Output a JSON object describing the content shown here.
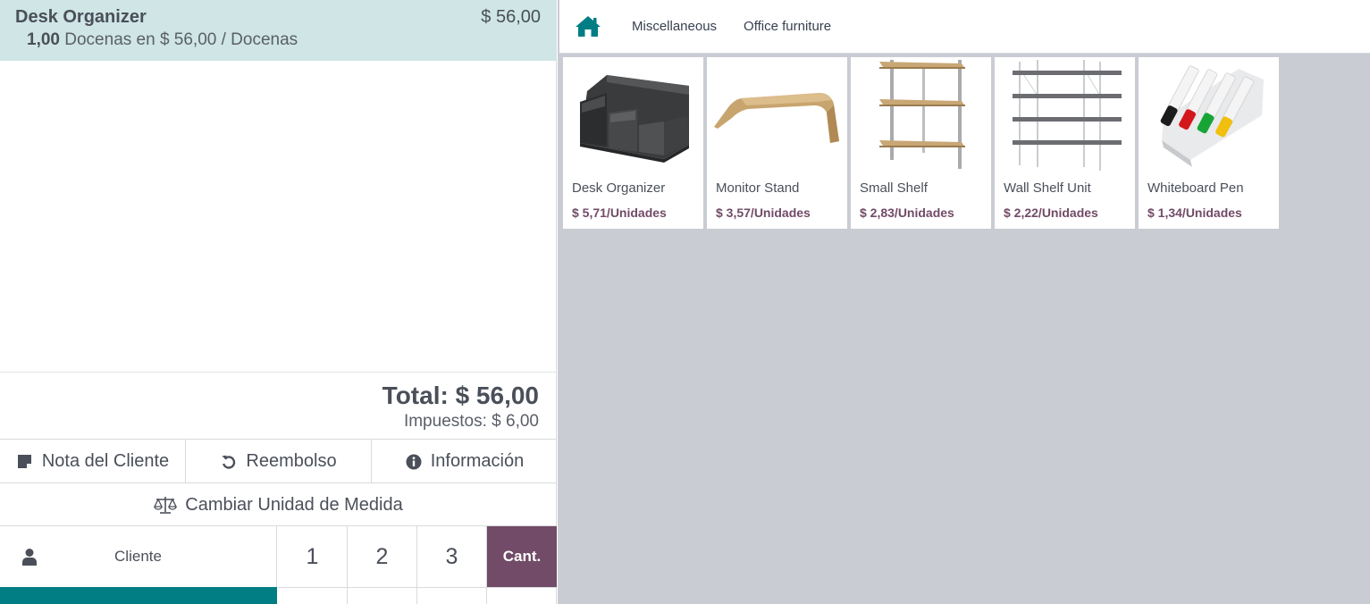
{
  "order": {
    "line": {
      "product": "Desk Organizer",
      "price": "$ 56,00",
      "quantity": "1,00",
      "unit_info": "Docenas en $ 56,00 / Docenas"
    },
    "total": "Total: $ 56,00",
    "taxes": "Impuestos: $ 6,00"
  },
  "controls": {
    "customer_note": "Nota del Cliente",
    "refund": "Reembolso",
    "info": "Información",
    "change_uom": "Cambiar Unidad de Medida"
  },
  "numpad": {
    "customer": "Cliente",
    "keys": [
      "1",
      "2",
      "3"
    ],
    "qty": "Cant."
  },
  "categories": {
    "home_icon": "home-icon",
    "items": [
      "Miscellaneous",
      "Office furniture"
    ]
  },
  "products": [
    {
      "name": "Desk Organizer",
      "price": "$ 5,71/Unidades"
    },
    {
      "name": "Monitor Stand",
      "price": "$ 3,57/Unidades"
    },
    {
      "name": "Small Shelf",
      "price": "$ 2,83/Unidades"
    },
    {
      "name": "Wall Shelf Unit",
      "price": "$ 2,22/Unidades"
    },
    {
      "name": "Whiteboard Pen",
      "price": "$ 1,34/Unidades"
    }
  ],
  "colors": {
    "selected_line": "#cfe5e6",
    "accent_teal": "#017e84",
    "accent_purple": "#714b67",
    "product_area": "#c9ccd3"
  }
}
